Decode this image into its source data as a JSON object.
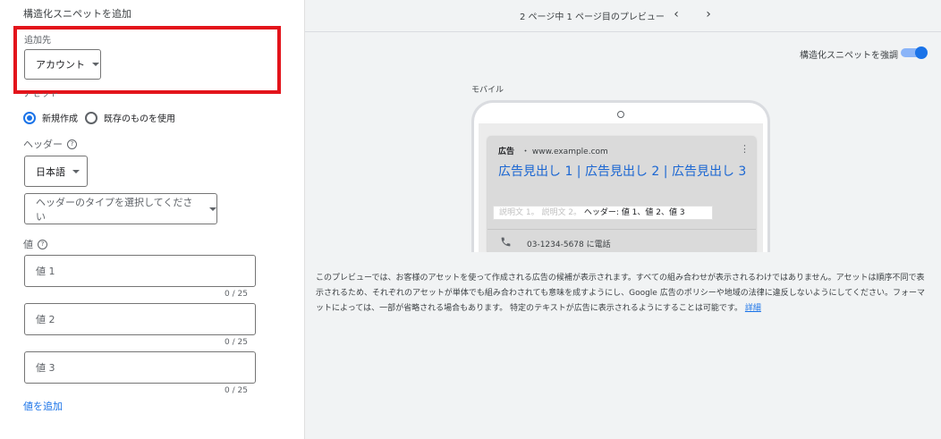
{
  "left": {
    "title": "構造化スニペットを追加",
    "add_to": {
      "label": "追加先",
      "dropdown_value": "アカウント"
    },
    "asset": {
      "label": "アセット",
      "options": [
        "新規作成",
        "既存のものを使用"
      ],
      "selected": "新規作成"
    },
    "header": {
      "label": "ヘッダー",
      "language_value": "日本語",
      "type_placeholder": "ヘッダーのタイプを選択してください"
    },
    "values": {
      "label": "値",
      "fields": [
        {
          "placeholder": "値 1",
          "counter": "0 / 25"
        },
        {
          "placeholder": "値 2",
          "counter": "0 / 25"
        },
        {
          "placeholder": "値 3",
          "counter": "0 / 25"
        }
      ],
      "add_link": "値を追加"
    }
  },
  "right": {
    "pager_text": "2 ページ中 1 ページ目のプレビュー",
    "toggle_label": "構造化スニペットを強調",
    "toggle_on": true,
    "device_label": "モバイル",
    "ad": {
      "label": "広告",
      "url": "・ www.example.com",
      "headline": "広告見出し 1 | 広告見出し 2 | 広告見出し 3",
      "desc_placeholder": "説明文 1。 説明文 2。",
      "snippet": "ヘッダー: 値 1、値 2、値 3",
      "call_text": "03-1234-5678 に電話"
    },
    "footnote": "このプレビューでは、お客様のアセットを使って作成される広告の候補が表示されます。すべての組み合わせが表示されるわけではありません。アセットは順序不同で表示されるため、それぞれのアセットが単体でも組み合わされても意味を成すようにし、Google 広告のポリシーや地域の法律に違反しないようにしてください。フォーマットによっては、一部が省略される場合もあります。 特定のテキストが広告に表示されるようにすることは可能です。",
    "footnote_link": "詳細"
  },
  "colors": {
    "accent": "#1a73e8",
    "highlight_box": "#e3141b",
    "headline_link": "#1a66d2"
  }
}
